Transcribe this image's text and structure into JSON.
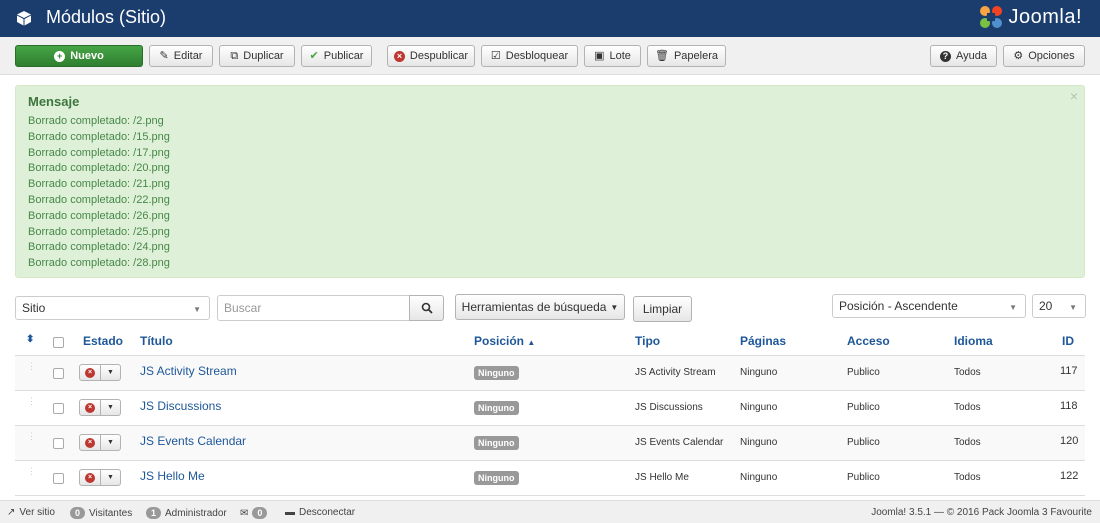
{
  "header": {
    "title": "Módulos (Sitio)",
    "logo_text": "Joomla!"
  },
  "toolbar": {
    "nuevo": "Nuevo",
    "editar": "Editar",
    "duplicar": "Duplicar",
    "publicar": "Publicar",
    "despublicar": "Despublicar",
    "desbloquear": "Desbloquear",
    "lote": "Lote",
    "papelera": "Papelera",
    "ayuda": "Ayuda",
    "opciones": "Opciones"
  },
  "message": {
    "title": "Mensaje",
    "items": [
      "Borrado completado: /2.png",
      "Borrado completado: /15.png",
      "Borrado completado: /17.png",
      "Borrado completado: /20.png",
      "Borrado completado: /21.png",
      "Borrado completado: /22.png",
      "Borrado completado: /26.png",
      "Borrado completado: /25.png",
      "Borrado completado: /24.png",
      "Borrado completado: /28.png"
    ]
  },
  "filters": {
    "client": "Sitio",
    "search_placeholder": "Buscar",
    "tools": "Herramientas de búsqueda",
    "clear": "Limpiar",
    "ordering": "Posición - Ascendente",
    "limit": "20"
  },
  "table": {
    "headers": {
      "estado": "Estado",
      "titulo": "Título",
      "posicion": "Posición",
      "tipo": "Tipo",
      "paginas": "Páginas",
      "acceso": "Acceso",
      "idioma": "Idioma",
      "id": "ID"
    },
    "rows": [
      {
        "title": "JS Activity Stream",
        "position": "Ninguno",
        "type": "JS Activity Stream",
        "pages": "Ninguno",
        "access": "Publico",
        "language": "Todos",
        "id": "117"
      },
      {
        "title": "JS Discussions",
        "position": "Ninguno",
        "type": "JS Discussions",
        "pages": "Ninguno",
        "access": "Publico",
        "language": "Todos",
        "id": "118"
      },
      {
        "title": "JS Events Calendar",
        "position": "Ninguno",
        "type": "JS Events Calendar",
        "pages": "Ninguno",
        "access": "Publico",
        "language": "Todos",
        "id": "120"
      },
      {
        "title": "JS Hello Me",
        "position": "Ninguno",
        "type": "JS Hello Me",
        "pages": "Ninguno",
        "access": "Publico",
        "language": "Todos",
        "id": "122"
      }
    ]
  },
  "footer": {
    "ver_sitio": "Ver sitio",
    "visitantes_count": "0",
    "visitantes": "Visitantes",
    "admin_count": "1",
    "administrador": "Administrador",
    "mail_count": "0",
    "desconectar": "Desconectar",
    "version": "Joomla! 3.5.1 — © 2016 Pack Joomla 3 Favourite"
  },
  "colors": {
    "header": "#1b3d6e",
    "primary_link": "#1e5799",
    "success": "#46a546",
    "danger": "#bd362f"
  }
}
